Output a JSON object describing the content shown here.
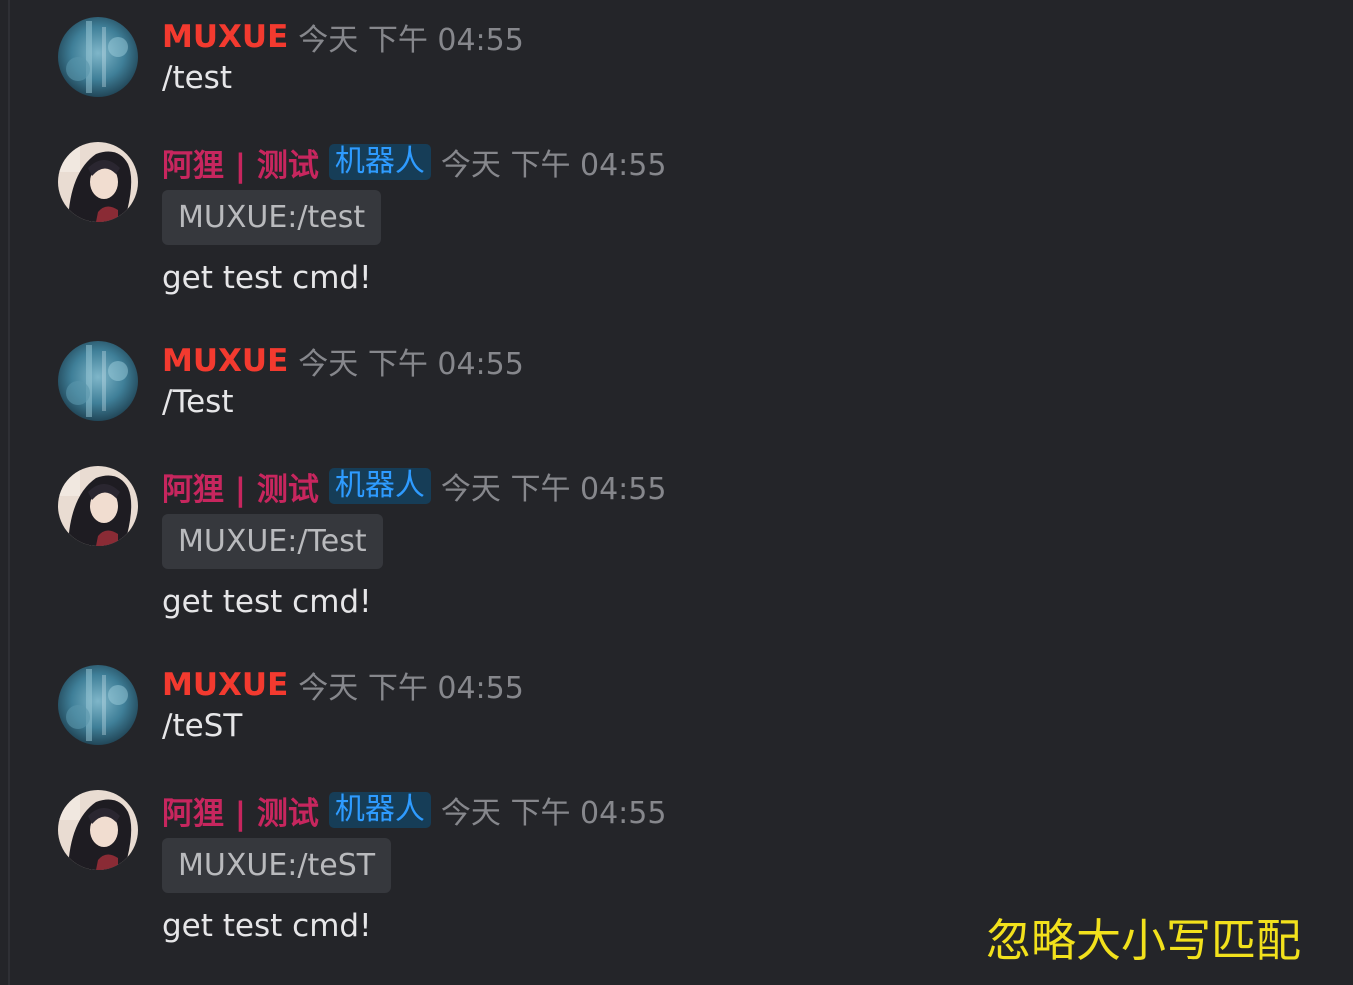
{
  "colors": {
    "background": "#242529",
    "user_name": "#f33a2f",
    "bot_name": "#c7265e",
    "bot_badge_text": "#2e9bff",
    "bot_badge_bg": "#163d57",
    "timestamp": "#86878c",
    "caption": "#f2e11c"
  },
  "messages": [
    {
      "kind": "user",
      "author": "MUXUE",
      "time": "今天 下午 04:55",
      "text": "/test"
    },
    {
      "kind": "bot",
      "author": "阿狸 | 测试",
      "badge": "机器人",
      "time": "今天 下午 04:55",
      "quote": "MUXUE:/test",
      "text": "get test cmd!"
    },
    {
      "kind": "user",
      "author": "MUXUE",
      "time": "今天 下午 04:55",
      "text": "/Test"
    },
    {
      "kind": "bot",
      "author": "阿狸 | 测试",
      "badge": "机器人",
      "time": "今天 下午 04:55",
      "quote": "MUXUE:/Test",
      "text": "get test cmd!"
    },
    {
      "kind": "user",
      "author": "MUXUE",
      "time": "今天 下午 04:55",
      "text": "/teST"
    },
    {
      "kind": "bot",
      "author": "阿狸 | 测试",
      "badge": "机器人",
      "time": "今天 下午 04:55",
      "quote": "MUXUE:/teST",
      "text": "get test cmd!"
    }
  ],
  "caption": "忽略大小写匹配"
}
